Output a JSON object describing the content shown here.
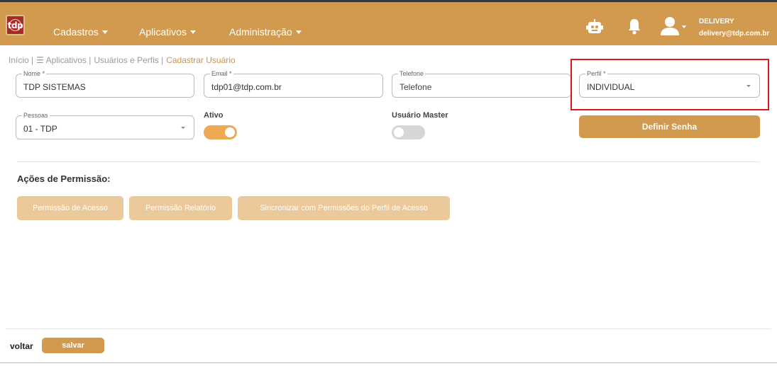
{
  "header": {
    "logo_text": "tdp",
    "nav": [
      "Cadastros",
      "Aplicativos",
      "Administração"
    ],
    "user": {
      "name": "DELIVERY",
      "email": "delivery@tdp.com.br"
    }
  },
  "breadcrumb": {
    "items": [
      "Início |",
      "☰ Aplicativos |",
      "Usuários e Perfis |"
    ],
    "current": "Cadastrar Usuário"
  },
  "form": {
    "nome": {
      "label": "Nome *",
      "value": "TDP SISTEMAS"
    },
    "email": {
      "label": "Email *",
      "value": "tdp01@tdp.com.br"
    },
    "telefone": {
      "label": "Telefone",
      "placeholder": "Telefone"
    },
    "perfil": {
      "label": "Perfil *",
      "value": "INDIVIDUAL"
    },
    "pessoas": {
      "label": "Pessoas",
      "value": "01 - TDP"
    },
    "ativo": {
      "label": "Ativo",
      "on": true
    },
    "usuario_master": {
      "label": "Usuário Master",
      "on": false
    },
    "definir_senha": "Definir Senha"
  },
  "permissions": {
    "title": "Ações de Permissão:",
    "buttons": [
      "Permissão de Acesso",
      "Permissão Relatório",
      "Sincronizar com Permissões do Perfil de Acesso"
    ]
  },
  "footer": {
    "back": "voltar",
    "save": "salvar"
  },
  "colors": {
    "brand": "#d29a4f",
    "disabled": "#ecc99a",
    "highlight": "#e0141c",
    "toggle_off": "#d6d6d6"
  }
}
